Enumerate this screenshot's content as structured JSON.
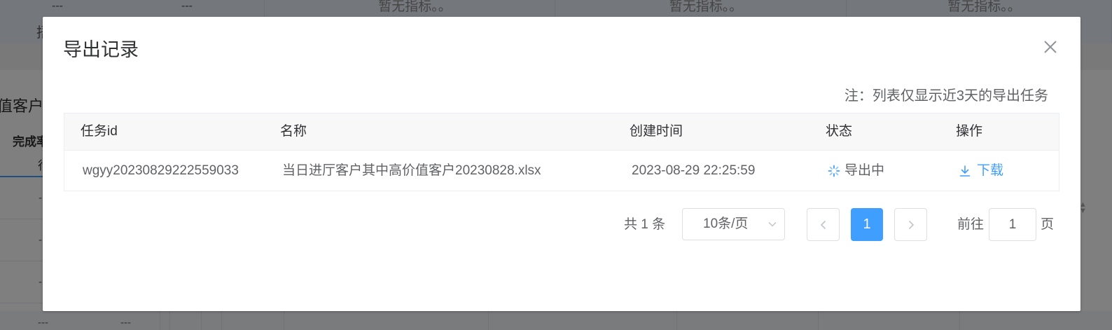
{
  "background": {
    "top_cells": [
      {
        "dash_a": "---",
        "dash_b": "---"
      },
      {
        "placeholder": "暂无指标。。"
      },
      {
        "placeholder": "暂无指标。。"
      },
      {
        "placeholder": "暂无指标。。"
      }
    ],
    "top_left_fragment": "捂",
    "section_label": "值客户",
    "tab_label": "完成率",
    "tab_label_second_line": "行",
    "row_dashes": [
      "-",
      "-",
      "-"
    ],
    "bottom_dashes": [
      "---",
      "---"
    ]
  },
  "dialog": {
    "title": "导出记录",
    "close_icon": "close-icon",
    "note": "注：列表仅显示近3天的导出任务",
    "table": {
      "columns": [
        "任务id",
        "名称",
        "创建时间",
        "状态",
        "操作"
      ],
      "rows": [
        {
          "id": "wgyy20230829222559033",
          "name": "当日进厅客户其中高价值客户20230828.xlsx",
          "created": "2023-08-29 22:25:59",
          "status": "导出中",
          "status_icon": "loading-icon",
          "action": "下载",
          "action_icon": "download-icon"
        }
      ]
    },
    "pagination": {
      "total": "共 1 条",
      "page_size": "10条/页",
      "current_page": "1",
      "goto_label": "前往",
      "goto_value": "1",
      "goto_suffix": "页"
    }
  },
  "colors": {
    "accent": "#409eff",
    "overlay": "rgba(0,0,0,0.5)"
  }
}
